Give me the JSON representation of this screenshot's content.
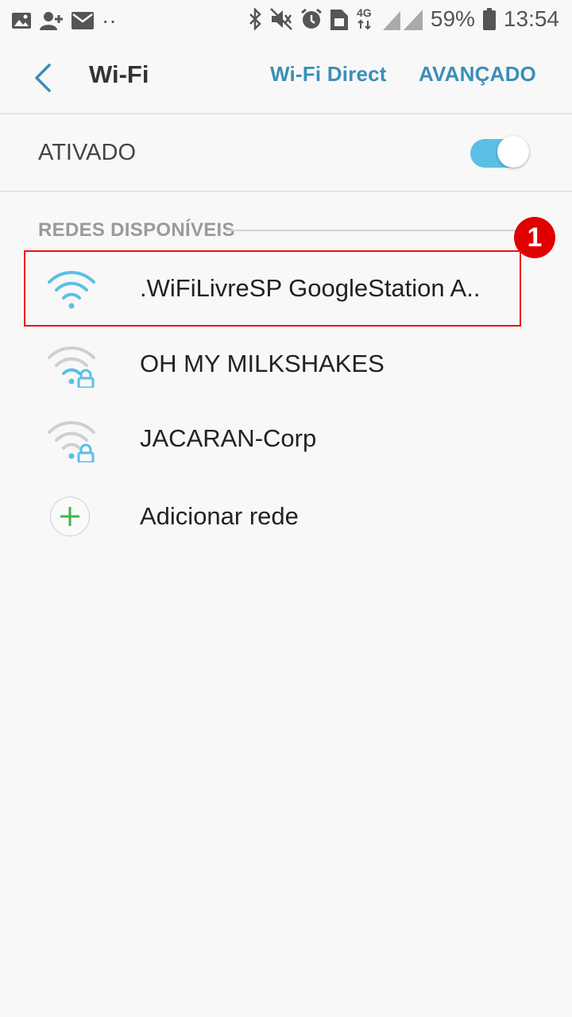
{
  "status_bar": {
    "battery": "59%",
    "time": "13:54",
    "network_type": "4G",
    "dots": "··",
    "icons": [
      "image-icon",
      "add-contact-icon",
      "mail-icon",
      "bluetooth-icon",
      "mute-icon",
      "alarm-icon",
      "sim-icon",
      "network-icon",
      "signal-icon",
      "battery-icon"
    ]
  },
  "header": {
    "title": "Wi-Fi",
    "wifi_direct": "Wi-Fi Direct",
    "advanced": "AVANÇADO"
  },
  "toggle": {
    "label": "ATIVADO",
    "on": true,
    "color": "#5bbfe6"
  },
  "section": {
    "title": "REDES DISPONÍVEIS",
    "badge": "1"
  },
  "networks": [
    {
      "name": ".WiFiLivreSP GoogleStation A..",
      "secured": false,
      "connected": true
    },
    {
      "name": "OH MY MILKSHAKES",
      "secured": true,
      "connected": false
    },
    {
      "name": "JACARAN-Corp",
      "secured": true,
      "connected": false
    }
  ],
  "add_network": {
    "label": "Adicionar rede"
  },
  "colors": {
    "accent": "#3a8fb7",
    "wifi_active": "#5bbfe6",
    "highlight": "#e11111",
    "badge": "#e00000"
  }
}
